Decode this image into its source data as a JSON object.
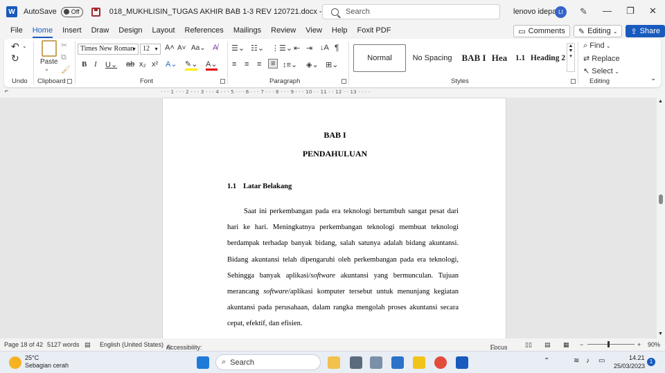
{
  "titlebar": {
    "app_logo": "W",
    "autosave_label": "AutoSave",
    "autosave_state": "Off",
    "document_title": "018_MUKHLISIN_TUGAS AKHIR BAB 1-3 REV 120721.docx  -  Compatibility Mode",
    "search_placeholder": "Search",
    "user_name": "lenovo idepad",
    "user_initials": "LI"
  },
  "ribbon_tabs": [
    "File",
    "Home",
    "Insert",
    "Draw",
    "Design",
    "Layout",
    "References",
    "Mailings",
    "Review",
    "View",
    "Help",
    "Foxit PDF"
  ],
  "ribbon_actions": {
    "comments": "Comments",
    "editing": "Editing",
    "share": "Share"
  },
  "ribbon": {
    "undo_group": "Undo",
    "clipboard_group": "Clipboard",
    "paste_label": "Paste",
    "font_group": "Font",
    "font_name": "Times New Roman",
    "font_size": "12",
    "paragraph_group": "Paragraph",
    "styles_group": "Styles",
    "styles": [
      "Normal",
      "No Spacing",
      "BAB I",
      "Hea",
      "1.1",
      "Heading 2"
    ],
    "editing_group": "Editing",
    "find_label": "Find",
    "replace_label": "Replace",
    "select_label": "Select"
  },
  "ruler_text": "· · · 1 · · · 2 · · · 3 · · · 4 · · · 5 · · · 6 · · · 7 · · · 8 · · · 9 · · · 10 · · 11 · · 12 · · 13 · · · ·",
  "document": {
    "chapter": "BAB I",
    "chapter_title": "PENDAHULUAN",
    "section_number": "1.1",
    "section_title": "Latar Belakang",
    "para_part1": "Saat ini perkembangan pada era teknologi bertumbuh sangat pesat dari hari ke hari. Meningkatnya perkembangan teknologi membuat teknologi berdampak terhadap banyak bidang, salah satunya adalah bidang akuntansi. Bidang akuntansi telah dipengaruhi oleh perkembangan pada era teknologi, Sehingga banyak aplikasi/",
    "para_italic1": "software",
    "para_part2": " akuntansi yang bermunculan. Tujuan merancang ",
    "para_italic2": "software",
    "para_part3": "/aplikasi komputer tersebut untuk menunjang kegiatan akuntansi pada perusahaan, dalam rangka mengolah proses akuntansi secara cepat, efektif, dan efisien."
  },
  "statusbar": {
    "page": "Page 18 of 42",
    "words": "5127 words",
    "language": "English (United States)",
    "accessibility": "Accessibility: Investigate",
    "focus": "Focus",
    "zoom": "90%"
  },
  "taskbar": {
    "temperature": "25°C",
    "weather": "Sebagian cerah",
    "search_label": "Search",
    "time": "14.21",
    "date": "25/03/2023",
    "notification_count": "1"
  }
}
